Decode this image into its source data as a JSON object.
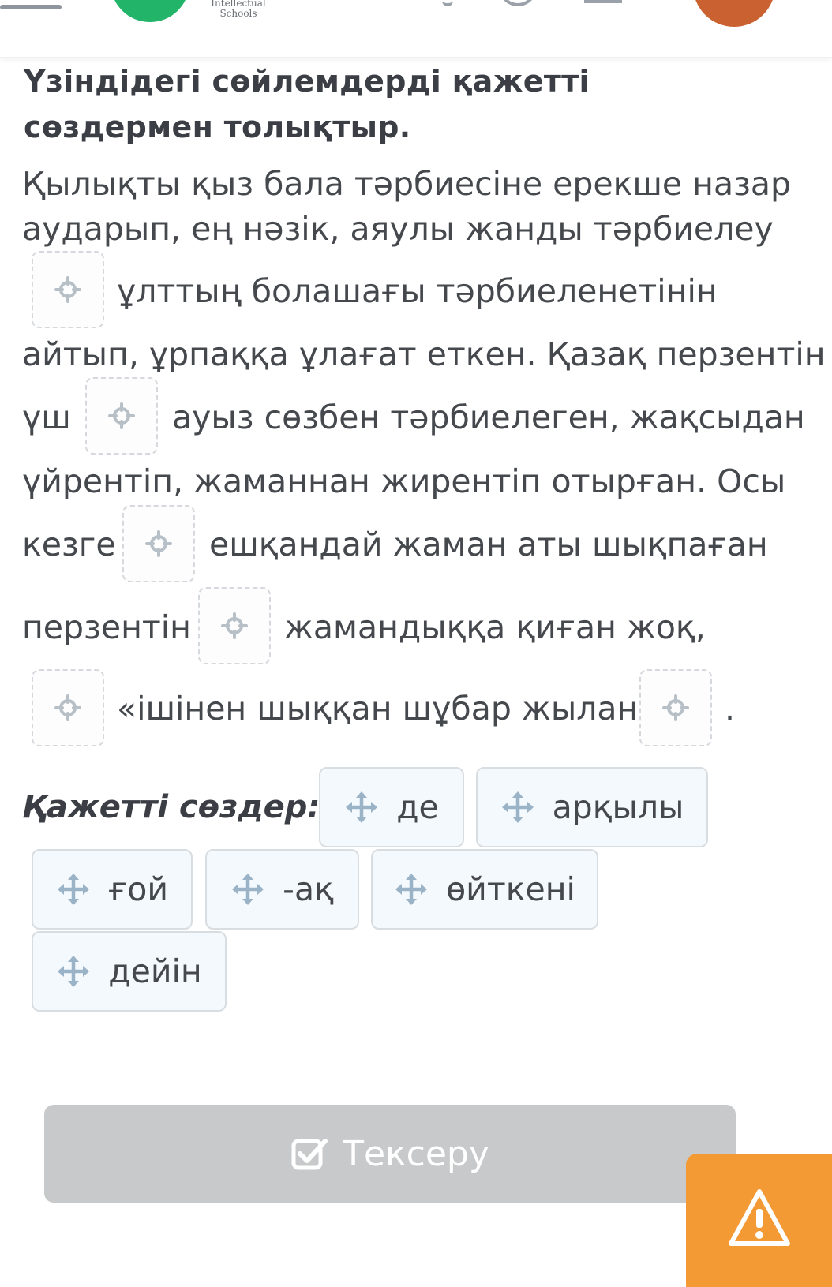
{
  "header": {
    "logo_line1": "Intellectual",
    "logo_line2": "Schools"
  },
  "question": {
    "title_line1": "Үзіндідегі сөйлемдерді қажетті",
    "title_line2": "сөздермен толықтыр."
  },
  "passage": {
    "l1": "Қылықты қыз бала тәрбиесіне ерекше назар",
    "l2": "аударып, ең нәзік, аяулы жанды тәрбиелеу",
    "l3": "ұлттың болашағы тәрбиеленетінін",
    "l4": "айтып, ұрпаққа ұлағат еткен. Қазақ перзентін",
    "l5a": "үш",
    "l5b": "ауыз сөзбен тәрбиелеген, жақсыдан",
    "l6": "үйрентіп, жаманнан жирентіп отырған. Осы",
    "l7a": "кезге",
    "l7b": "ешқандай жаман аты шықпаған",
    "l8a": "перзентін",
    "l8b": "жамандыққа қиған жоқ,",
    "l9": "«ішінен шыққан шұбар жылан»",
    "l9end": "."
  },
  "words": {
    "label": "Қажетті сөздер:",
    "items": [
      "де",
      "арқылы",
      "ғой",
      "-ақ",
      "өйткені",
      "дейін"
    ]
  },
  "footer": {
    "check_label": "Тексеру"
  },
  "colors": {
    "logo_green": "#22b56a",
    "avatar_orange": "#c96230",
    "report_orange": "#f39a35",
    "check_disabled": "#c8c9ca"
  },
  "icons": [
    "menu-icon",
    "target-icon",
    "move-icon",
    "checkbox-icon",
    "warning-icon"
  ]
}
